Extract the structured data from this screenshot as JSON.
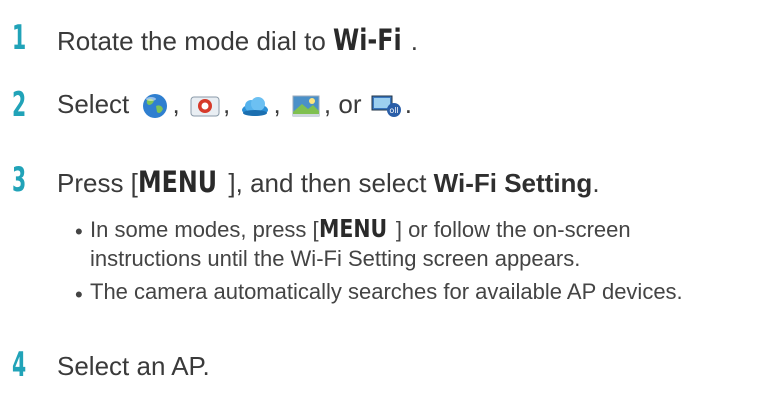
{
  "steps": [
    {
      "number": "1",
      "text_before": "Rotate the mode dial to ",
      "mode_name": "Wi-Fi",
      "text_after": "."
    },
    {
      "number": "2",
      "text_before": "Select ",
      "separator": ",",
      "or_text": ", or",
      "end": ".",
      "icons": [
        "globe-icon",
        "email-icon",
        "cloud-icon",
        "photo-share-icon",
        "tv-link-icon"
      ]
    },
    {
      "number": "3",
      "text_before": "Press [",
      "key": "MENU",
      "text_middle": "], and then select ",
      "setting": "Wi-Fi Setting",
      "text_after": ".",
      "bullets": [
        {
          "line1_before": "In some modes, press [",
          "key": "MENU",
          "line1_after": "] or follow the on-screen",
          "line2": "instructions until the Wi-Fi Setting screen appears."
        },
        {
          "line1": "The camera automatically searches for available AP devices."
        }
      ]
    },
    {
      "number": "4",
      "text": "Select an AP."
    }
  ],
  "bullet_char": "•",
  "colors": {
    "step_number": "#21a3b8",
    "text": "#3a3a3a"
  }
}
